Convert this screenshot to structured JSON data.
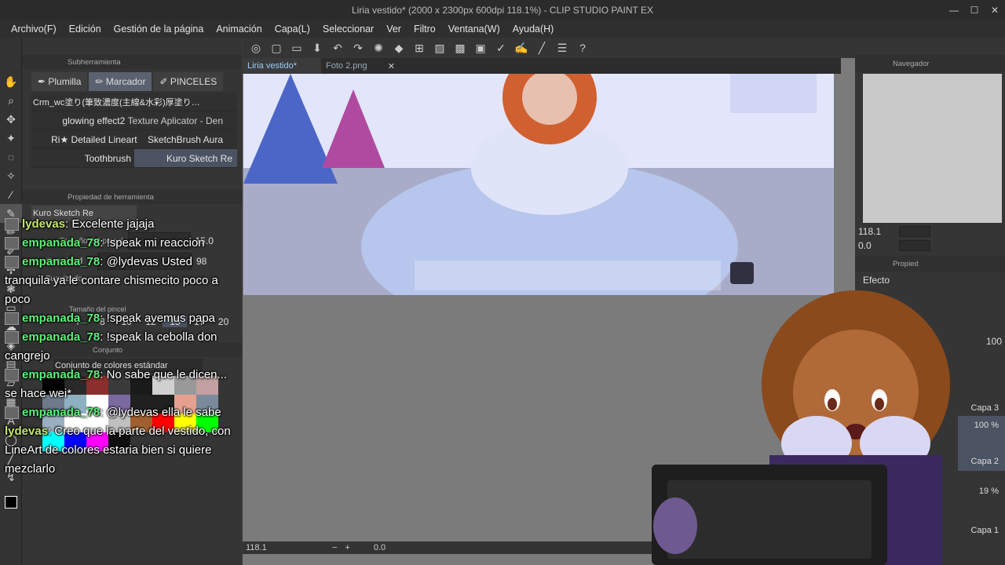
{
  "window": {
    "title": "Liria vestido* (2000 x 2300px 600dpi 118.1%) - CLIP STUDIO PAINT EX",
    "minimize": "—",
    "maximize": "☐",
    "close": "✕"
  },
  "menu": [
    "Archivo(F)",
    "Edición",
    "Gestión de la página",
    "Animación",
    "Capa(L)",
    "Seleccionar",
    "Ver",
    "Filtro",
    "Ventana(W)",
    "Ayuda(H)"
  ],
  "left_panel": {
    "subtool_header": "Subherramienta",
    "subtool_tabs": [
      "Plumilla",
      "Marcador",
      "PINCELES"
    ],
    "brushes": [
      "Crm_wc塗り(筆致濃度(主線&水彩)厚塗り…",
      "glowing effect2",
      "Texture Aplicator - Den",
      "Ri★ Detailed Lineart",
      "SketchBrush Aura",
      "Toothbrush",
      "Kuro Sketch Re"
    ],
    "tool_property_header": "Propiedad de herramienta",
    "current_brush": "Kuro Sketch Re",
    "brush_size_label": "Tamaño del pincel",
    "brush_size_value": "15.0",
    "opacity_label": "Opacidad",
    "opacity_value": "98",
    "smoothing_label": "Suavizado",
    "size_panel_label": "Tamaño del pincel",
    "size_presets": [
      "7",
      "8",
      "10",
      "12",
      "15",
      "17",
      "20"
    ],
    "color_set_header": "Conjunto",
    "color_set_name": "Conjunto de colores estándar"
  },
  "doc_tabs": [
    "Liria vestido*",
    "Foto 2.png"
  ],
  "status": {
    "zoom": "118.1",
    "angle": "0.0"
  },
  "navigator": {
    "header": "Navegador",
    "zoom": "118.1",
    "angle": "0.0"
  },
  "layer_property": {
    "header": "Propied",
    "effect_label": "Efecto",
    "opacity_value": "100"
  },
  "layers": [
    {
      "name": "Capa 3",
      "opacity": "100 %"
    },
    {
      "name": "Capa 2",
      "opacity": "19 %"
    },
    {
      "name": "Capa 1",
      "opacity": ""
    }
  ],
  "chat": [
    {
      "user": "lydevas",
      "message": "Excelente jajaja"
    },
    {
      "user": "empanada_78",
      "message": "!speak mi reaccion"
    },
    {
      "user": "empanada_78",
      "message": "@lydevas Usted tranquila ya le contare chismecito poco a poco"
    },
    {
      "user": "empanada_78",
      "message": "!speak avemus papa"
    },
    {
      "user": "empanada_78",
      "message": "!speak la cebolla don cangrejo"
    },
    {
      "user": "empanada_78",
      "message": "No sabe que le dicen... se hace wei*"
    },
    {
      "user": "empanada_78",
      "message": "@lydevas ella le sabe"
    },
    {
      "user": "lydevas",
      "message": "Creo que la parte del vestido, con LineArt de colores estaria bien si quiere mezclarlo"
    }
  ],
  "colors": {
    "accent_green": "#5cf27a",
    "accent_yellowgreen": "#c6e86a",
    "panel_bg": "#353535",
    "palette": [
      "#000000",
      "#2a2a2a",
      "#8a2e2e",
      "#3a3a3a",
      "#1a1a1a",
      "#d0d0d0",
      "#999999",
      "#c0a0a0",
      "#6c7a8a",
      "#8fb0c0",
      "#ffffff",
      "#7a6aa0",
      "#202020",
      "#202020",
      "#e6a090",
      "#7a8a9a",
      "#9ab0c0",
      "#ffffff",
      "#ffffff",
      "#c0c0c0",
      "#a06030",
      "#ff0000",
      "#ffff00",
      "#00ff00",
      "#00ffff",
      "#0000ff",
      "#ff00ff",
      "#101010"
    ]
  }
}
